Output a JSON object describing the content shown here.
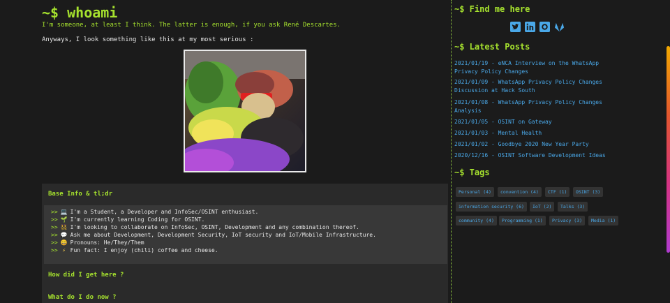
{
  "main": {
    "title": "~$ whoami",
    "tagline": "I'm someone, at least I think. The latter is enough, if you ask René Descartes.",
    "intro": "Anyways, I look something like this at my most serious :",
    "base_info": {
      "heading": "Base Info & tl;dr",
      "arrow": ">>",
      "rows": [
        {
          "emoji": "💻",
          "text": "I'm a Student, a Developer and InfoSec/OSINT enthusiast."
        },
        {
          "emoji": "🌱",
          "text": "I'm currently learning Coding for OSINT."
        },
        {
          "emoji": "👯",
          "text": "I'm looking to collaborate on InfoSec, OSINT, Development and any combination thereof."
        },
        {
          "emoji": "💬",
          "text": "Ask me about Development, Development Security, IoT security and IoT/Mobile Infrastructure."
        },
        {
          "emoji": "😄",
          "text": "Pronouns: He/They/Them"
        },
        {
          "emoji": "⚡",
          "text": "Fun fact: I enjoy (chili) coffee and cheese."
        }
      ]
    },
    "how_did_i": "How did I get here ?",
    "what_do_i": "What do I do now ?"
  },
  "sidebar": {
    "find_me": "~$ Find me here",
    "social": [
      "twitter-icon",
      "linkedin-icon",
      "github-icon",
      "gitlab-icon"
    ],
    "latest_posts_heading": "~$ Latest Posts",
    "posts": [
      "2021/01/19 - eNCA Interview on the WhatsApp Privacy Policy Changes",
      "2021/01/09 - WhatsApp Privacy Policy Changes Discussion at Hack South",
      "2021/01/08 - WhatsApp Privacy Policy Changes Analysis",
      "2021/01/05 - OSINT on Gateway",
      "2021/01/03 - Mental Health",
      "2021/01/02 - Goodbye 2020 New Year Party",
      "2020/12/16 - OSINT Software Development Ideas"
    ],
    "tags_heading": "~$ Tags",
    "tags": [
      "Personal (4)",
      "convention (4)",
      "CTF (1)",
      "OSINT (3)",
      "information security (6)",
      "IoT (2)",
      "Talks (3)",
      "community (4)",
      "Programming (1)",
      "Privacy (3)",
      "Media (1)"
    ]
  },
  "colors": {
    "accent": "#a6e22e",
    "link": "#4aa8e8",
    "bg": "#1b1b1b"
  }
}
